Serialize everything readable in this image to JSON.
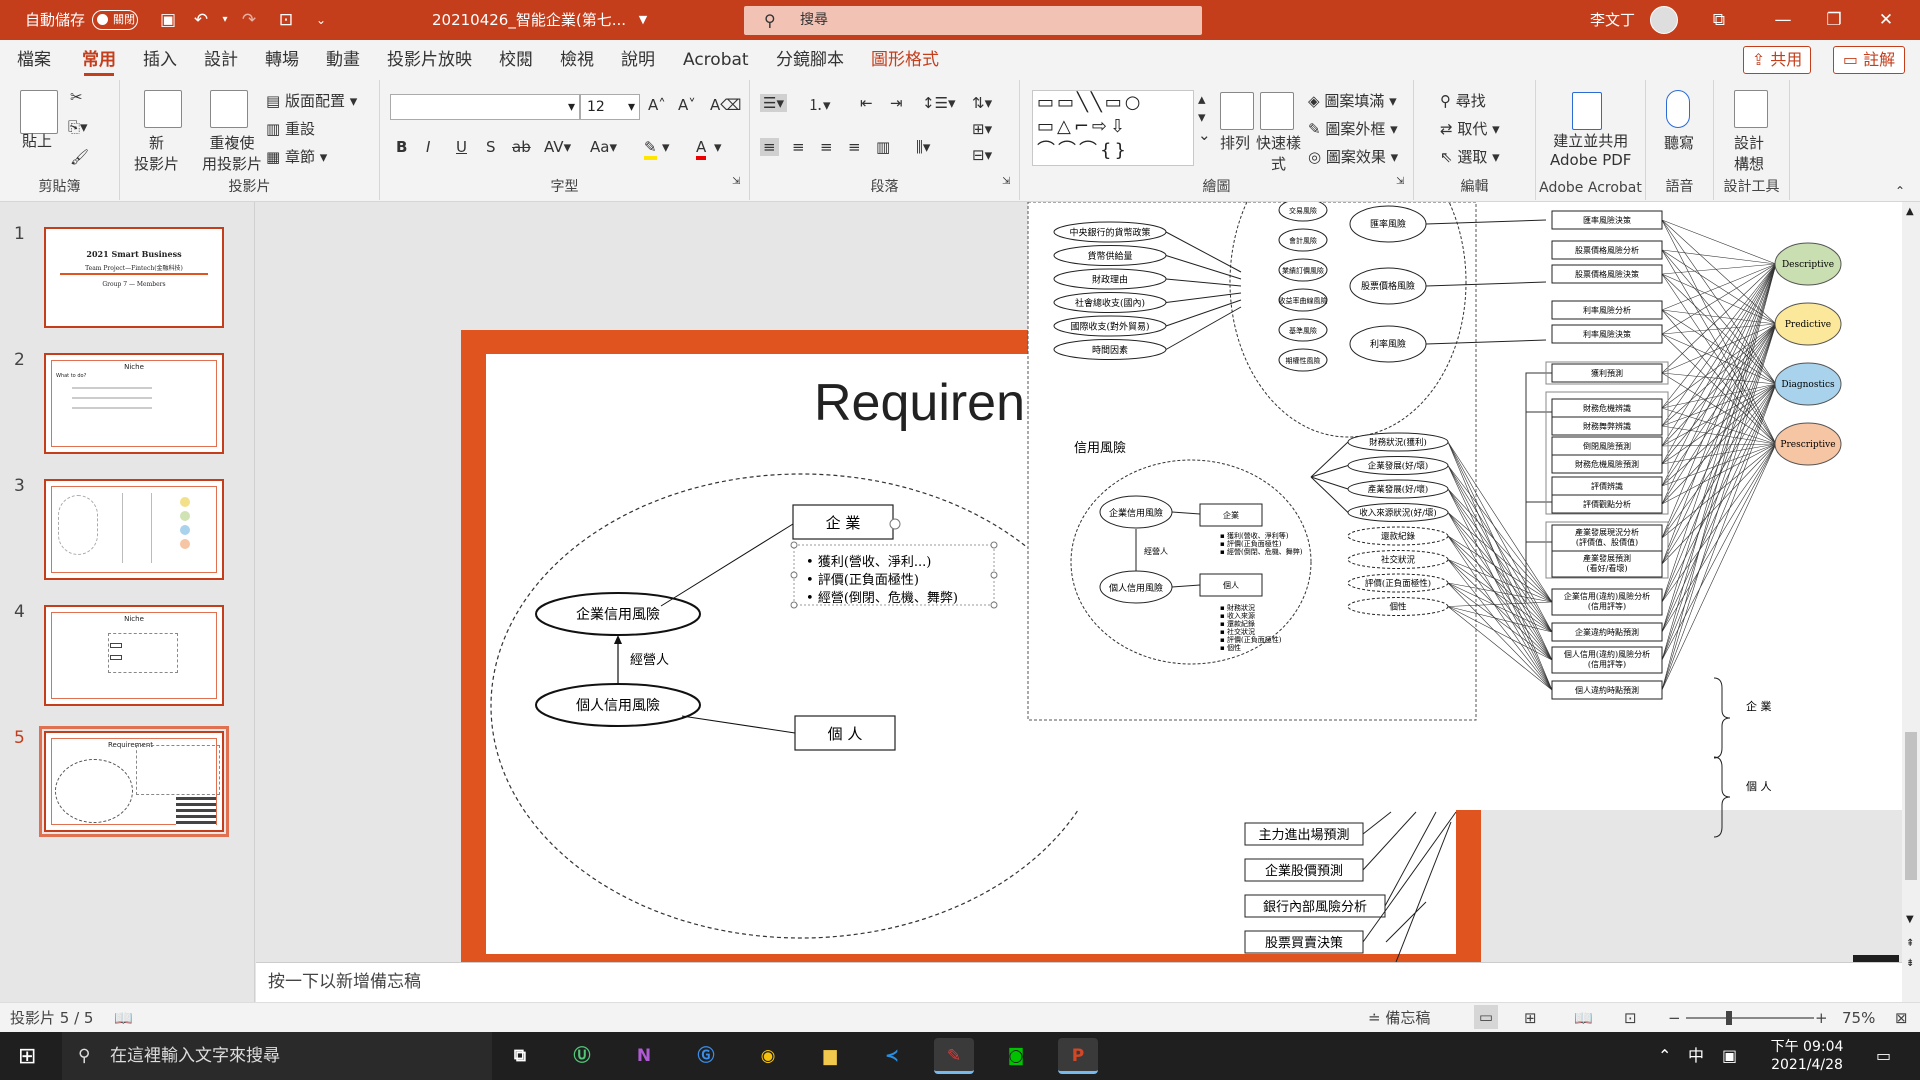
{
  "titlebar": {
    "autosave_label": "自動儲存",
    "autosave_state": "關閉",
    "doc_title": "20210426_智能企業(第七...",
    "search_placeholder": "搜尋",
    "user_name": "李文丁"
  },
  "menu": {
    "tabs": [
      "檔案",
      "常用",
      "插入",
      "設計",
      "轉場",
      "動畫",
      "投影片放映",
      "校閱",
      "檢視",
      "說明",
      "Acrobat",
      "分鏡腳本",
      "圖形格式"
    ],
    "active": "常用",
    "share_label": "共用",
    "comment_label": "註解"
  },
  "ribbon": {
    "clipboard": {
      "paste": "貼上",
      "label": "剪貼簿"
    },
    "slides": {
      "new_slide": "新\n投影片",
      "reuse": "重複使\n用投影片",
      "layout": "版面配置",
      "reset": "重設",
      "section": "章節",
      "label": "投影片"
    },
    "font": {
      "font_name": "",
      "font_size": "12",
      "label": "字型"
    },
    "paragraph": {
      "label": "段落"
    },
    "drawing": {
      "arrange": "排列",
      "quick_styles": "快速樣\n式",
      "shape_fill": "圖案填滿",
      "shape_outline": "圖案外框",
      "shape_effects": "圖案效果",
      "label": "繪圖"
    },
    "editing": {
      "find": "尋找",
      "replace": "取代",
      "select": "選取",
      "label": "編輯"
    },
    "acrobat": {
      "create": "建立並共用\nAdobe PDF",
      "label": "Adobe Acrobat"
    },
    "voice": {
      "dictate": "聽寫",
      "label": "語音"
    },
    "designer": {
      "ideas": "設計\n構想",
      "label": "設計工具"
    }
  },
  "thumbnails": [
    {
      "num": "1",
      "title": "2021 Smart Business",
      "subtitle": "Team Project—Fintech(金融科技)",
      "line3": "Group 7 — Members"
    },
    {
      "num": "2",
      "title": "Niche",
      "subtitle": "What to do?"
    },
    {
      "num": "3",
      "title": ""
    },
    {
      "num": "4",
      "title": "Niche"
    },
    {
      "num": "5",
      "title": "Requirement"
    }
  ],
  "slide": {
    "title": "Requiren",
    "enterprise_box": "企 業",
    "personal_box": "個 人",
    "enterprise_risk": "企業信用風險",
    "personal_risk": "個人信用風險",
    "operator": "經營人",
    "bullets": [
      "獲利(營收、淨利...)",
      "評價(正負面極性)",
      "經營(倒閉、危機、舞弊)"
    ],
    "bottom_boxes": [
      "主力進出場預測",
      "企業股價預測",
      "銀行內部風險分析",
      "股票買賣決策"
    ]
  },
  "overlay": {
    "left_ovals": [
      "中央銀行的貨幣政策",
      "貨幣供給量",
      "財政理由",
      "社會總收支(國內)",
      "國際收支(對外貿易)",
      "時間因素"
    ],
    "market_risks": [
      "匯率風險",
      "股票價格風險",
      "利率風險"
    ],
    "small_ovals": [
      "交易風險",
      "會計風險",
      "業績訂價風險",
      "收益率曲線風險",
      "基準風險",
      "期權性風險"
    ],
    "credit_title": "信用風險",
    "credit_nodes": [
      "企業信用風險",
      "個人信用風險",
      "經營人"
    ],
    "credit_boxes": [
      "企業",
      "個人"
    ],
    "enterprise_items": [
      "獲利(營收、淨利等)",
      "評價(正負面極性)",
      "經營(倒閉、危機、舞弊)"
    ],
    "personal_items": [
      "財務狀況",
      "收入來源",
      "還款紀錄",
      "社交狀況",
      "評價(正負面極性)",
      "個性"
    ],
    "mid_ovals": [
      "財務狀況(獲利)",
      "企業發展(好/壞)",
      "產業發展(好/壞)",
      "收入來源狀況(好/壞)",
      "還款紀錄",
      "社交狀況",
      "評價(正負面極性)",
      "個性"
    ],
    "right_boxes": [
      "匯率風險決策",
      "股票價格風險分析",
      "股票價格風險決策",
      "利率風險分析",
      "利率風險決策",
      "獲利預測",
      "財務危機辨識",
      "財務舞弊辨識",
      "倒閉風險預測",
      "財務危機風險預測",
      "評價辨識",
      "評價觀點分析",
      "產業發展現況分析\n(評價值、股價值)",
      "產業發展預測\n(看好/看壞)",
      "企業信用(違約)風險分析\n(信用評等)",
      "企業違約時點預測",
      "個人信用(違約)風險分析\n(信用評等)",
      "個人違約時點預測"
    ],
    "analytics": [
      {
        "label": "Descriptive",
        "color": "#c9dfb2"
      },
      {
        "label": "Predictive",
        "color": "#fbe89a"
      },
      {
        "label": "Diagnostics",
        "color": "#a9d3ec"
      },
      {
        "label": "Prescriptive",
        "color": "#f6c5a3"
      }
    ],
    "brace_enterprise": "企\n業",
    "brace_personal": "個\n人"
  },
  "notes_placeholder": "按一下以新增備忘稿",
  "status": {
    "slide_counter": "投影片 5 / 5",
    "notes_btn": "備忘稿",
    "zoom": "75%"
  },
  "taskbar": {
    "search_placeholder": "在這裡輸入文字來搜尋",
    "ime": "中",
    "time": "下午 09:04",
    "date": "2021/4/28"
  },
  "colors": {
    "accent": "#c43e1c",
    "slide_frame": "#e0541f"
  }
}
